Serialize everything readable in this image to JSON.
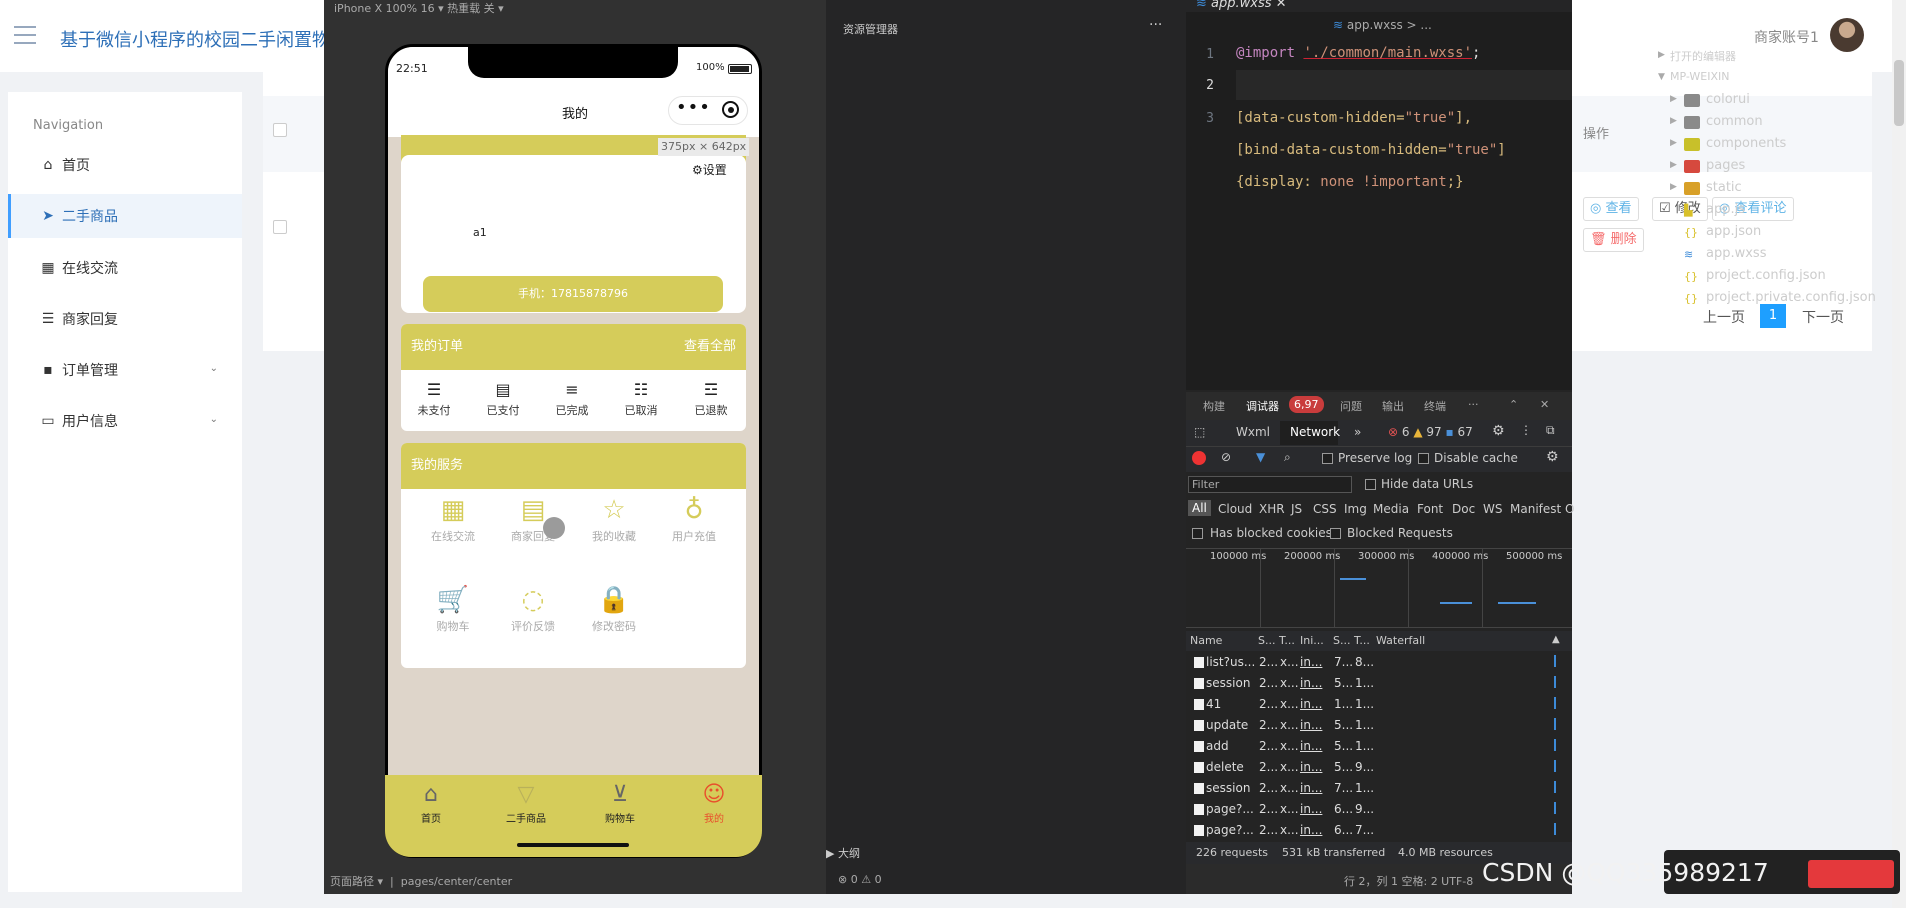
{
  "admin": {
    "site_title": "基于微信小程序的校园二手闲置物",
    "account": "商家账号1",
    "nav_header": "Navigation",
    "nav": [
      {
        "label": "首页",
        "icon": "home-icon"
      },
      {
        "label": "二手商品",
        "icon": "send-icon"
      },
      {
        "label": "在线交流",
        "icon": "grid-icon"
      },
      {
        "label": "商家回复",
        "icon": "sliders-icon"
      },
      {
        "label": "订单管理",
        "icon": "comment-icon"
      },
      {
        "label": "用户信息",
        "icon": "card-icon"
      }
    ],
    "table": {
      "op_header": "操作"
    },
    "actions": {
      "view": "查看",
      "edit": "修改",
      "view_reviews": "查看评论",
      "delete": "删除"
    },
    "pager": {
      "prev": "上一页",
      "current": "1",
      "next": "下一页"
    }
  },
  "simulator": {
    "top": "iPhone X 100% 16 ▾     热重载 关 ▾",
    "time": "22:51",
    "battery": "100%",
    "nav_title": "我的",
    "size_chip": "375px × 642px",
    "settings": "设置",
    "username": "a1",
    "phone_btn": "手机：17815878796",
    "orders": {
      "title": "我的订单",
      "view_all": "查看全部",
      "items": [
        "未支付",
        "已支付",
        "已完成",
        "已取消",
        "已退款"
      ]
    },
    "services": {
      "title": "我的服务",
      "items": [
        "在线交流",
        "商家回复",
        "我的收藏",
        "用户充值",
        "购物车",
        "评价反馈",
        "修改密码"
      ]
    },
    "tabs": [
      "首页",
      "二手商品",
      "购物车",
      "我的"
    ],
    "bottom_path_label": "页面路径 ▾",
    "bottom_path": "pages/center/center"
  },
  "explorer": {
    "title": "资源管理器",
    "open_editors": "打开的编辑器",
    "project": "MP-WEIXIN",
    "folders": [
      "colorui",
      "common",
      "components",
      "pages",
      "static"
    ],
    "files": [
      "app.js",
      "app.json",
      "app.wxss",
      "project.config.json",
      "project.private.config.json"
    ],
    "outline": "大纲",
    "bottom": "⊗ 0 ⚠ 0"
  },
  "editor": {
    "tab": "app.wxss",
    "breadcrumb": "app.wxss > ...",
    "lines": [
      {
        "n": "1",
        "a": "@import ",
        "b": "'./common/main.wxss'",
        "c": ";"
      },
      {
        "n": "2",
        "a": "",
        "b": "",
        "c": ""
      },
      {
        "n": "3",
        "a": "[data-custom-hidden=",
        "b": "\"true\"",
        "c": "],"
      },
      {
        "n": "",
        "a": "[bind-data-custom-hidden=",
        "b": "\"true\"",
        "c": "]"
      },
      {
        "n": "",
        "a": "{display: ",
        "b": "none !important",
        "c": ";}"
      }
    ]
  },
  "devtools": {
    "tabs": [
      "构建",
      "调试器",
      "问题",
      "输出",
      "终端"
    ],
    "badge": "6,97",
    "panel_tabs": [
      "Wxml",
      "Network"
    ],
    "counts": {
      "errors": "6",
      "warnings": "97",
      "info": "67"
    },
    "preserve_log": "Preserve log",
    "disable_cache": "Disable cache",
    "filter_placeholder": "Filter",
    "hide_data_urls": "Hide data URLs",
    "types": [
      "All",
      "Cloud",
      "XHR",
      "JS",
      "CSS",
      "Img",
      "Media",
      "Font",
      "Doc",
      "WS",
      "Manifest",
      "O"
    ],
    "has_blocked": "Has blocked cookies",
    "blocked_requests": "Blocked Requests",
    "timeline_ticks": [
      "100000 ms",
      "200000 ms",
      "300000 ms",
      "400000 ms",
      "500000 ms"
    ],
    "columns": [
      "Name",
      "S...",
      "T...",
      "Ini...",
      "S...",
      "T...",
      "Waterfall"
    ],
    "rows": [
      {
        "name": "list?us...",
        "s": "2...",
        "t": "x...",
        "i": "in...",
        "sz": "7...",
        "tm": "8..."
      },
      {
        "name": "session",
        "s": "2...",
        "t": "x...",
        "i": "in...",
        "sz": "5...",
        "tm": "1..."
      },
      {
        "name": "41",
        "s": "2...",
        "t": "x...",
        "i": "in...",
        "sz": "1...",
        "tm": "1..."
      },
      {
        "name": "update",
        "s": "2...",
        "t": "x...",
        "i": "in...",
        "sz": "5...",
        "tm": "1..."
      },
      {
        "name": "add",
        "s": "2...",
        "t": "x...",
        "i": "in...",
        "sz": "5...",
        "tm": "1..."
      },
      {
        "name": "delete",
        "s": "2...",
        "t": "x...",
        "i": "in...",
        "sz": "5...",
        "tm": "9..."
      },
      {
        "name": "session",
        "s": "2...",
        "t": "x...",
        "i": "in...",
        "sz": "7...",
        "tm": "1..."
      },
      {
        "name": "page?...",
        "s": "2...",
        "t": "x...",
        "i": "in...",
        "sz": "6...",
        "tm": "9..."
      },
      {
        "name": "page?...",
        "s": "2...",
        "t": "x...",
        "i": "in...",
        "sz": "6...",
        "tm": "7..."
      }
    ],
    "footer": {
      "requests": "226 requests",
      "transferred": "531 kB transferred",
      "resources": "4.0 MB resources"
    },
    "status": "行 2，列 1   空格: 2   UTF-8"
  },
  "watermark": "CSDN @QQ335989217"
}
